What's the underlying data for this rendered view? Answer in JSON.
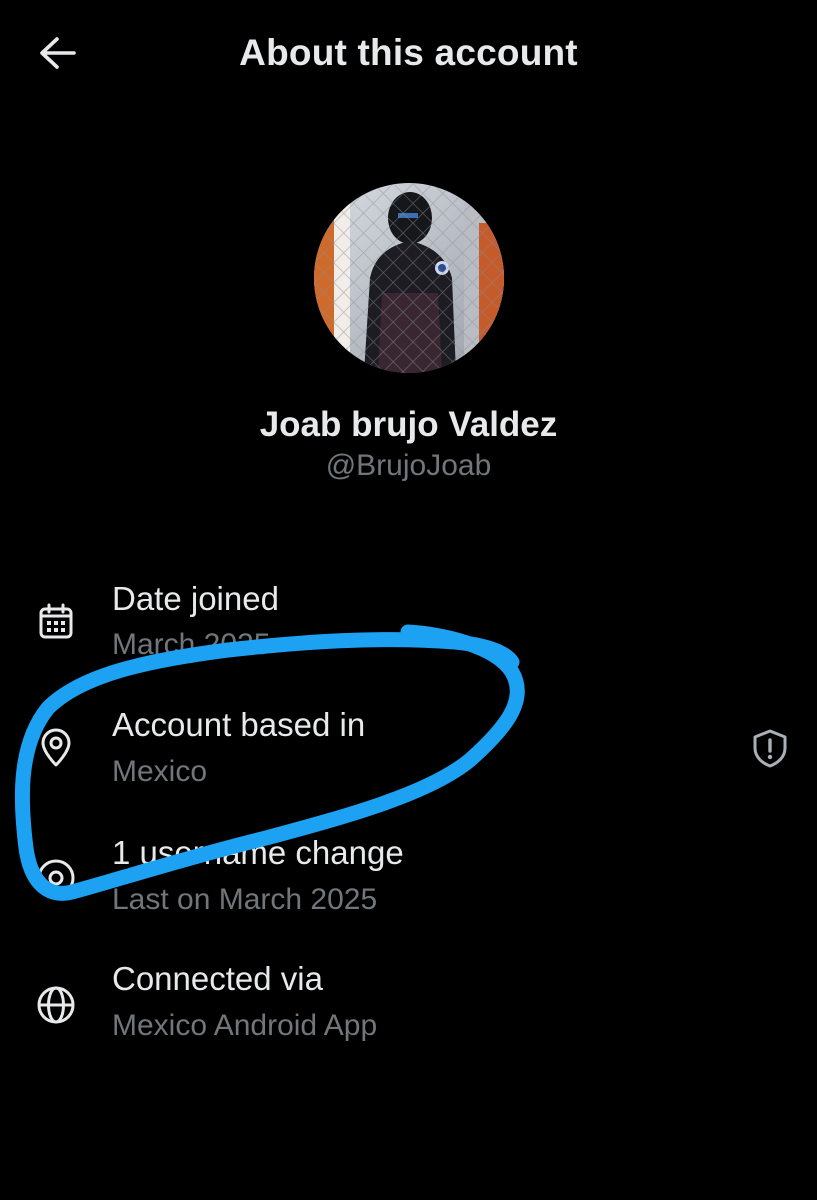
{
  "header": {
    "title": "About this account",
    "back_icon": "arrow-left-icon"
  },
  "profile": {
    "display_name": "Joab brujo Valdez",
    "handle": "@BrujoJoab"
  },
  "details": [
    {
      "icon": "calendar-icon",
      "label": "Date joined",
      "value": "March 2025"
    },
    {
      "icon": "location-pin-icon",
      "label": "Account based in",
      "value": "Mexico",
      "trailing_icon": "shield-alert-icon"
    },
    {
      "icon": "at-sign-icon",
      "label": "1 username change",
      "value": "Last on March 2025"
    },
    {
      "icon": "globe-icon",
      "label": "Connected via",
      "value": "Mexico Android App"
    }
  ],
  "colors": {
    "background": "#000000",
    "primary_text": "#e7e9ea",
    "secondary_text": "#71767b",
    "annotation": "#1da1f2"
  }
}
